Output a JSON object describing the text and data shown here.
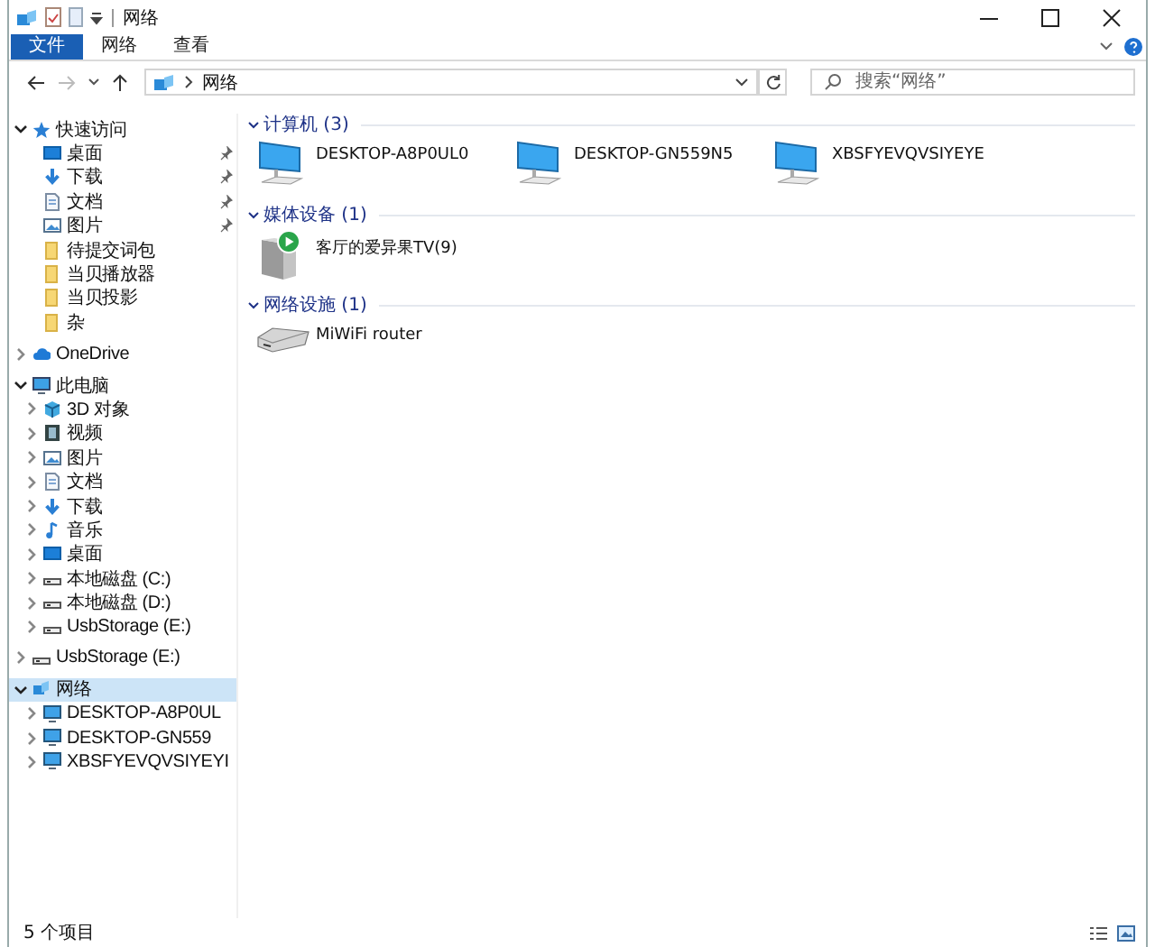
{
  "window": {
    "title": "网络"
  },
  "ribbon_tabs": [
    {
      "label": "文件",
      "selected": true
    },
    {
      "label": "网络",
      "selected": false
    },
    {
      "label": "查看",
      "selected": false
    }
  ],
  "navigation": {
    "back_disabled": false,
    "forward_disabled": true
  },
  "address_bar": {
    "path": [
      "网络"
    ]
  },
  "search": {
    "placeholder": "搜索“网络”"
  },
  "sidebar": {
    "items": [
      {
        "label": "快速访问",
        "kind": "star",
        "expanded": true,
        "selected": false,
        "children": [
          {
            "label": "桌面",
            "kind": "desktop",
            "selected": false,
            "pinned": true
          },
          {
            "label": "下载",
            "kind": "download",
            "selected": false,
            "pinned": true
          },
          {
            "label": "文档",
            "kind": "document",
            "selected": false,
            "pinned": true
          },
          {
            "label": "图片",
            "kind": "picture",
            "selected": false,
            "pinned": true
          },
          {
            "label": "待提交词包",
            "kind": "folder",
            "selected": false,
            "pinned": false
          },
          {
            "label": "当贝播放器",
            "kind": "folder",
            "selected": false,
            "pinned": false
          },
          {
            "label": "当贝投影",
            "kind": "folder",
            "selected": false,
            "pinned": false
          },
          {
            "label": "杂",
            "kind": "folder",
            "selected": false,
            "pinned": false
          }
        ]
      },
      {
        "label": "OneDrive",
        "kind": "cloud",
        "expanded": false,
        "selected": false
      },
      {
        "label": "此电脑",
        "kind": "pc",
        "expanded": true,
        "selected": false,
        "children": [
          {
            "label": "3D 对象",
            "kind": "cube",
            "expanded": false,
            "selected": false
          },
          {
            "label": "视频",
            "kind": "video",
            "expanded": false,
            "selected": false
          },
          {
            "label": "图片",
            "kind": "picture",
            "expanded": false,
            "selected": false
          },
          {
            "label": "文档",
            "kind": "document",
            "expanded": false,
            "selected": false
          },
          {
            "label": "下载",
            "kind": "download",
            "expanded": false,
            "selected": false
          },
          {
            "label": "音乐",
            "kind": "music",
            "expanded": false,
            "selected": false
          },
          {
            "label": "桌面",
            "kind": "desktop",
            "expanded": false,
            "selected": false
          },
          {
            "label": "本地磁盘 (C:)",
            "kind": "drive",
            "expanded": false,
            "selected": false
          },
          {
            "label": "本地磁盘 (D:)",
            "kind": "drive",
            "expanded": false,
            "selected": false
          },
          {
            "label": "UsbStorage (E:)",
            "kind": "drive",
            "expanded": false,
            "selected": false
          }
        ]
      },
      {
        "label": "UsbStorage (E:)",
        "kind": "drive",
        "expanded": false,
        "selected": false
      },
      {
        "label": "网络",
        "kind": "network",
        "expanded": true,
        "selected": true,
        "children": [
          {
            "label": "DESKTOP-A8P0UL",
            "kind": "monitor",
            "expanded": false,
            "selected": false
          },
          {
            "label": "DESKTOP-GN559",
            "kind": "monitor",
            "expanded": false,
            "selected": false
          },
          {
            "label": "XBSFYEVQVSIYEYI",
            "kind": "monitor",
            "expanded": false,
            "selected": false
          }
        ]
      }
    ]
  },
  "groups": [
    {
      "title": "计算机 (3)",
      "expanded": true,
      "items": [
        {
          "label": "DESKTOP-A8P0UL0",
          "kind": "computer"
        },
        {
          "label": "DESKTOP-GN559N5",
          "kind": "computer"
        },
        {
          "label": "XBSFYEVQVSIYEYE",
          "kind": "computer"
        }
      ]
    },
    {
      "title": "媒体设备 (1)",
      "expanded": true,
      "items": [
        {
          "label": "客厅的爱异果TV(9)",
          "kind": "media"
        }
      ]
    },
    {
      "title": "网络设施 (1)",
      "expanded": true,
      "items": [
        {
          "label": "MiWiFi router",
          "kind": "router"
        }
      ]
    }
  ],
  "status_bar": {
    "text": "5 个项目"
  }
}
